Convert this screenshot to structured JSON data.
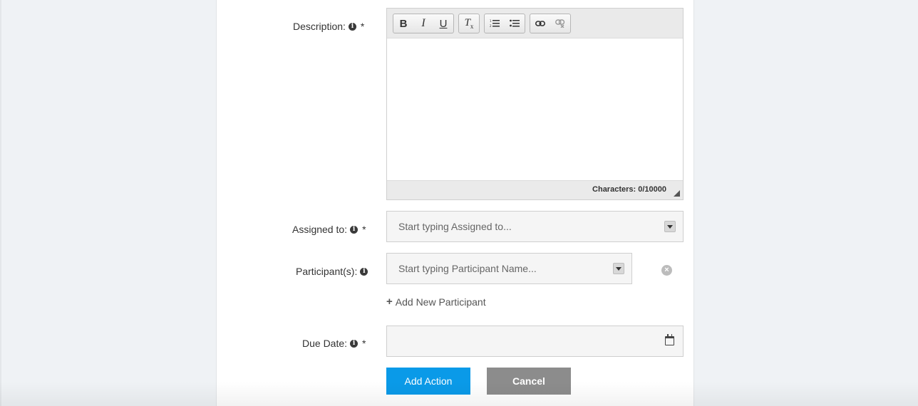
{
  "form": {
    "description": {
      "label": "Description:",
      "required_mark": "*",
      "toolbar": {
        "bold": "B",
        "italic": "I",
        "underline": "U",
        "clear_format": "Tx"
      },
      "char_counter": "Characters: 0/10000"
    },
    "assigned_to": {
      "label": "Assigned to:",
      "required_mark": "*",
      "placeholder": "Start typing Assigned to..."
    },
    "participants": {
      "label": "Participant(s):",
      "placeholder": "Start typing Participant Name...",
      "add_link": "Add New Participant"
    },
    "due_date": {
      "label": "Due Date:",
      "required_mark": "*",
      "value": ""
    },
    "buttons": {
      "submit": "Add Action",
      "cancel": "Cancel"
    }
  },
  "colors": {
    "page_background": "#eff2f5",
    "primary_button": "#0a9ae8",
    "cancel_button": "#8c8c8c"
  },
  "icons": [
    "info-icon",
    "bold-icon",
    "italic-icon",
    "underline-icon",
    "clear-format-icon",
    "numbered-list-icon",
    "bulleted-list-icon",
    "link-icon",
    "unlink-icon",
    "chevron-down-icon",
    "remove-icon",
    "plus-icon",
    "calendar-icon",
    "resize-handle-icon"
  ]
}
